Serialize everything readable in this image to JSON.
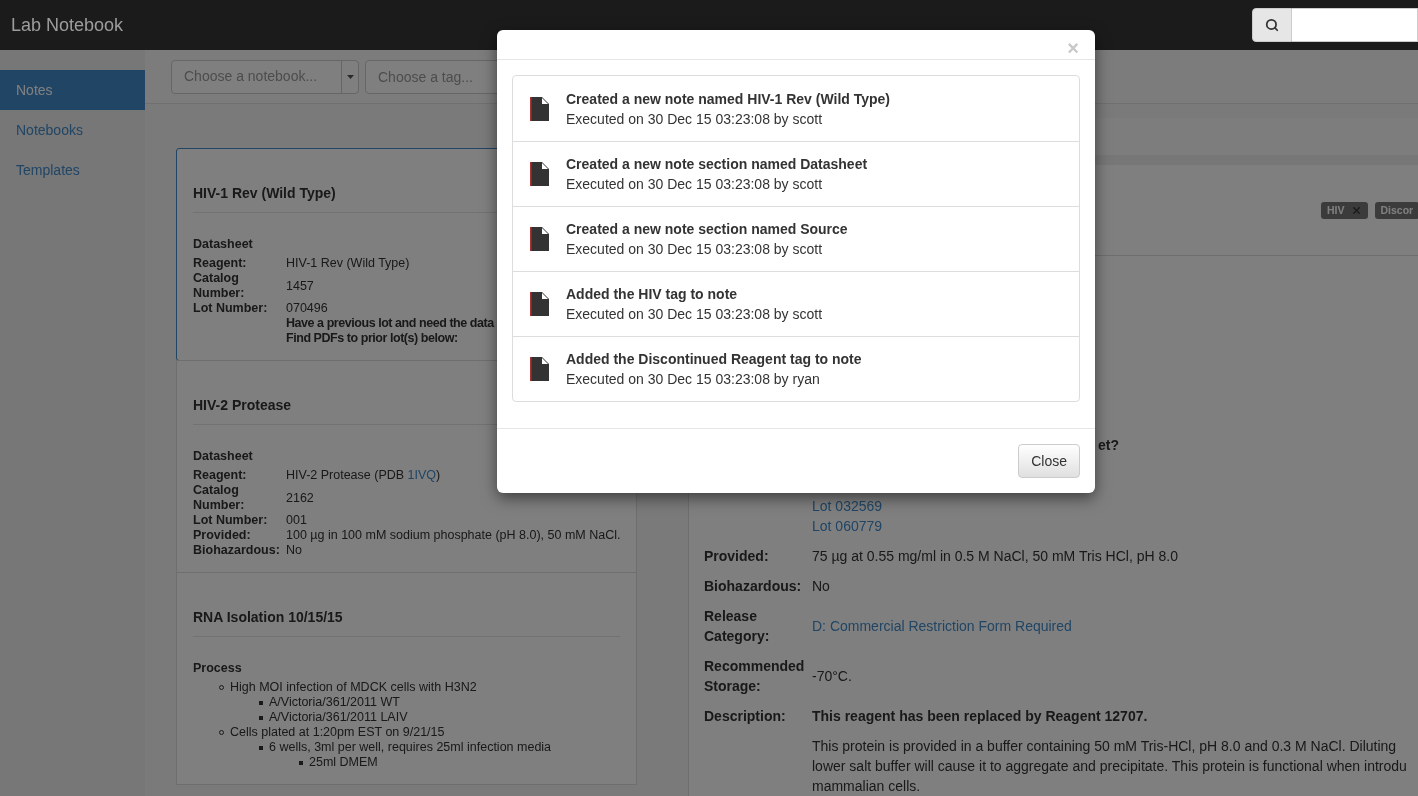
{
  "app": {
    "title": "Lab Notebook"
  },
  "sidebar": {
    "items": [
      {
        "label": "Notes",
        "selected": true
      },
      {
        "label": "Notebooks",
        "selected": false
      },
      {
        "label": "Templates",
        "selected": false
      }
    ]
  },
  "filters": [
    {
      "placeholder": "Choose a notebook...",
      "kind": "dropdown"
    },
    {
      "placeholder": "Choose a tag...",
      "kind": "text"
    }
  ],
  "notes": [
    {
      "title": "HIV-1 Rev (Wild Type)",
      "selected": true,
      "kind": "datasheet",
      "section": "Datasheet",
      "fields": [
        {
          "label": "Reagent:",
          "value": [
            {
              "text": "HIV-1 Rev (Wild Type)",
              "kind": "plain"
            }
          ]
        },
        {
          "label": "Catalog Number:",
          "value": [
            {
              "text": "1457",
              "kind": "plain"
            }
          ]
        },
        {
          "label": "Lot Number:",
          "value": [
            {
              "text": "070496",
              "kind": "plain"
            }
          ],
          "extra": [
            "Have a previous lot and need the data",
            "Find PDFs to prior lot(s) below:"
          ]
        }
      ]
    },
    {
      "title": "HIV-2 Protease",
      "selected": false,
      "kind": "datasheet",
      "section": "Datasheet",
      "fields": [
        {
          "label": "Reagent:",
          "value": [
            {
              "text": "HIV-2 Protease (PDB ",
              "kind": "plain"
            },
            {
              "text": "1IVQ",
              "kind": "link"
            },
            {
              "text": ")",
              "kind": "plain"
            }
          ]
        },
        {
          "label": "Catalog Number:",
          "value": [
            {
              "text": "2162",
              "kind": "plain"
            }
          ]
        },
        {
          "label": "Lot Number:",
          "value": [
            {
              "text": "001",
              "kind": "plain"
            }
          ]
        },
        {
          "label": "Provided:",
          "value": [
            {
              "text": "100 µg in 100 mM sodium phosphate (pH 8.0), 50 mM NaCl.",
              "kind": "plain"
            }
          ]
        },
        {
          "label": "Biohazardous:",
          "value": [
            {
              "text": "No",
              "kind": "plain"
            }
          ]
        }
      ]
    },
    {
      "title": "RNA Isolation 10/15/15",
      "selected": false,
      "kind": "process",
      "section": "Process",
      "list": [
        {
          "text": "High MOI infection of MDCK cells with H3N2",
          "children": [
            {
              "text": "A/Victoria/361/2011 WT"
            },
            {
              "text": "A/Victoria/361/2011 LAIV"
            }
          ]
        },
        {
          "text": "Cells plated at 1:20pm EST on 9/21/15",
          "children": [
            {
              "text": "6 wells, 3ml per well, requires 25ml infection media",
              "children": [
                {
                  "text": "25ml DMEM"
                }
              ]
            }
          ]
        }
      ]
    }
  ],
  "detail": {
    "tags": [
      {
        "label": "HIV",
        "removable": true
      },
      {
        "label": "Discor",
        "removable": false
      }
    ],
    "fragment": "et?",
    "lot_links": [
      "Lot 032569",
      "Lot 060779"
    ],
    "rows": [
      {
        "label": "Provided:",
        "value": "75 µg at 0.55 mg/ml in 0.5 M NaCl, 50 mM Tris HCl, pH 8.0",
        "kind": "text"
      },
      {
        "label": "Biohazardous:",
        "value": "No",
        "kind": "text"
      },
      {
        "label": "Release Category:",
        "value": "D: Commercial Restriction Form Required",
        "kind": "link"
      },
      {
        "label": "Recommended Storage:",
        "value": "-70°C.",
        "kind": "text"
      }
    ],
    "description": {
      "label": "Description:",
      "lead": "This reagent has been replaced by Reagent 12707.",
      "lines": [
        "This protein is provided in a buffer containing 50 mM Tris-HCl, pH 8.0 and 0.3 M NaCl. Diluting",
        "lower salt buffer will cause it to aggregate and precipitate. This protein is functional when introdu",
        "mammalian cells."
      ]
    }
  },
  "modal": {
    "close_glyph": "×",
    "entries": [
      {
        "title": "Created a new note named HIV-1 Rev (Wild Type)",
        "meta": "Executed on 30 Dec 15 03:23:08 by scott"
      },
      {
        "title": "Created a new note section named Datasheet",
        "meta": "Executed on 30 Dec 15 03:23:08 by scott"
      },
      {
        "title": "Created a new note section named Source",
        "meta": "Executed on 30 Dec 15 03:23:08 by scott"
      },
      {
        "title": "Added the HIV tag to note",
        "meta": "Executed on 30 Dec 15 03:23:08 by scott"
      },
      {
        "title": "Added the Discontinued Reagent tag to note",
        "meta": "Executed on 30 Dec 15 03:23:08 by ryan"
      }
    ],
    "button": "Close"
  }
}
